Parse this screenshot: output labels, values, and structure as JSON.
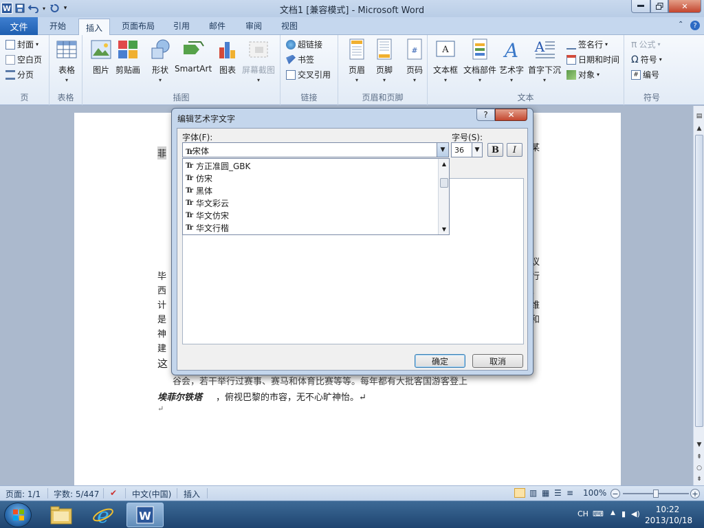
{
  "title_bar": {
    "title": "文档1 [兼容模式] - Microsoft Word",
    "app_icon": "W"
  },
  "ribbon_tabs": [
    "文件",
    "开始",
    "插入",
    "页面布局",
    "引用",
    "邮件",
    "审阅",
    "视图"
  ],
  "active_tab": "插入",
  "ribbon": {
    "pages": {
      "label": "页",
      "items": [
        "封面",
        "空白页",
        "分页"
      ]
    },
    "tables": {
      "label": "表格",
      "table": "表格"
    },
    "illustrations": {
      "label": "插图",
      "picture": "图片",
      "clipart": "剪贴画",
      "shapes": "形状",
      "smartart": "SmartArt",
      "chart": "图表",
      "screenshot": "屏幕截图"
    },
    "links": {
      "label": "链接",
      "hyperlink": "超链接",
      "bookmark": "书签",
      "crossref": "交叉引用"
    },
    "header_footer": {
      "label": "页眉和页脚",
      "header": "页眉",
      "footer": "页脚",
      "page_number": "页码"
    },
    "text": {
      "label": "文本",
      "textbox": "文本框",
      "quickparts": "文档部件",
      "wordart": "艺术字",
      "dropcap": "首字下沉",
      "signature": "签名行",
      "datetime": "日期和时间",
      "object": "对象"
    },
    "symbols": {
      "label": "符号",
      "equation": "公式",
      "symbol": "符号",
      "number": "编号"
    }
  },
  "document": {
    "top_left": "菲",
    "top_right": "某",
    "left_chars": [
      "毕",
      "西",
      "计",
      "是",
      "神",
      "建",
      "这"
    ],
    "right_chars": [
      "议",
      "行",
      "、",
      "维",
      "和"
    ],
    "line_partial": "谷会，若干举行过赛事、赛马和体育比赛等等。每年都有大批客国游客登上",
    "last_line_bold": "埃菲尔铁塔",
    "last_line_rest": "，俯视巴黎的市容，无不心旷神怡。↵",
    "paragraph_mark": "↵"
  },
  "dialog": {
    "title": "编辑艺术字文字",
    "help": "?",
    "font_label": "字体(F):",
    "font_value": "宋体",
    "font_options": [
      "方正准圆_GBK",
      "仿宋",
      "黑体",
      "华文彩云",
      "华文仿宋",
      "华文行楷"
    ],
    "size_label": "字号(S):",
    "size_value": "36",
    "bold": "B",
    "italic": "I",
    "ok": "确定",
    "cancel": "取消"
  },
  "status": {
    "page": "页面: 1/1",
    "words": "字数: 5/447",
    "language": "中文(中国)",
    "mode": "插入",
    "zoom": "100%"
  },
  "taskbar": {
    "input": "CH",
    "time": "10:22",
    "date": "2013/10/18"
  }
}
